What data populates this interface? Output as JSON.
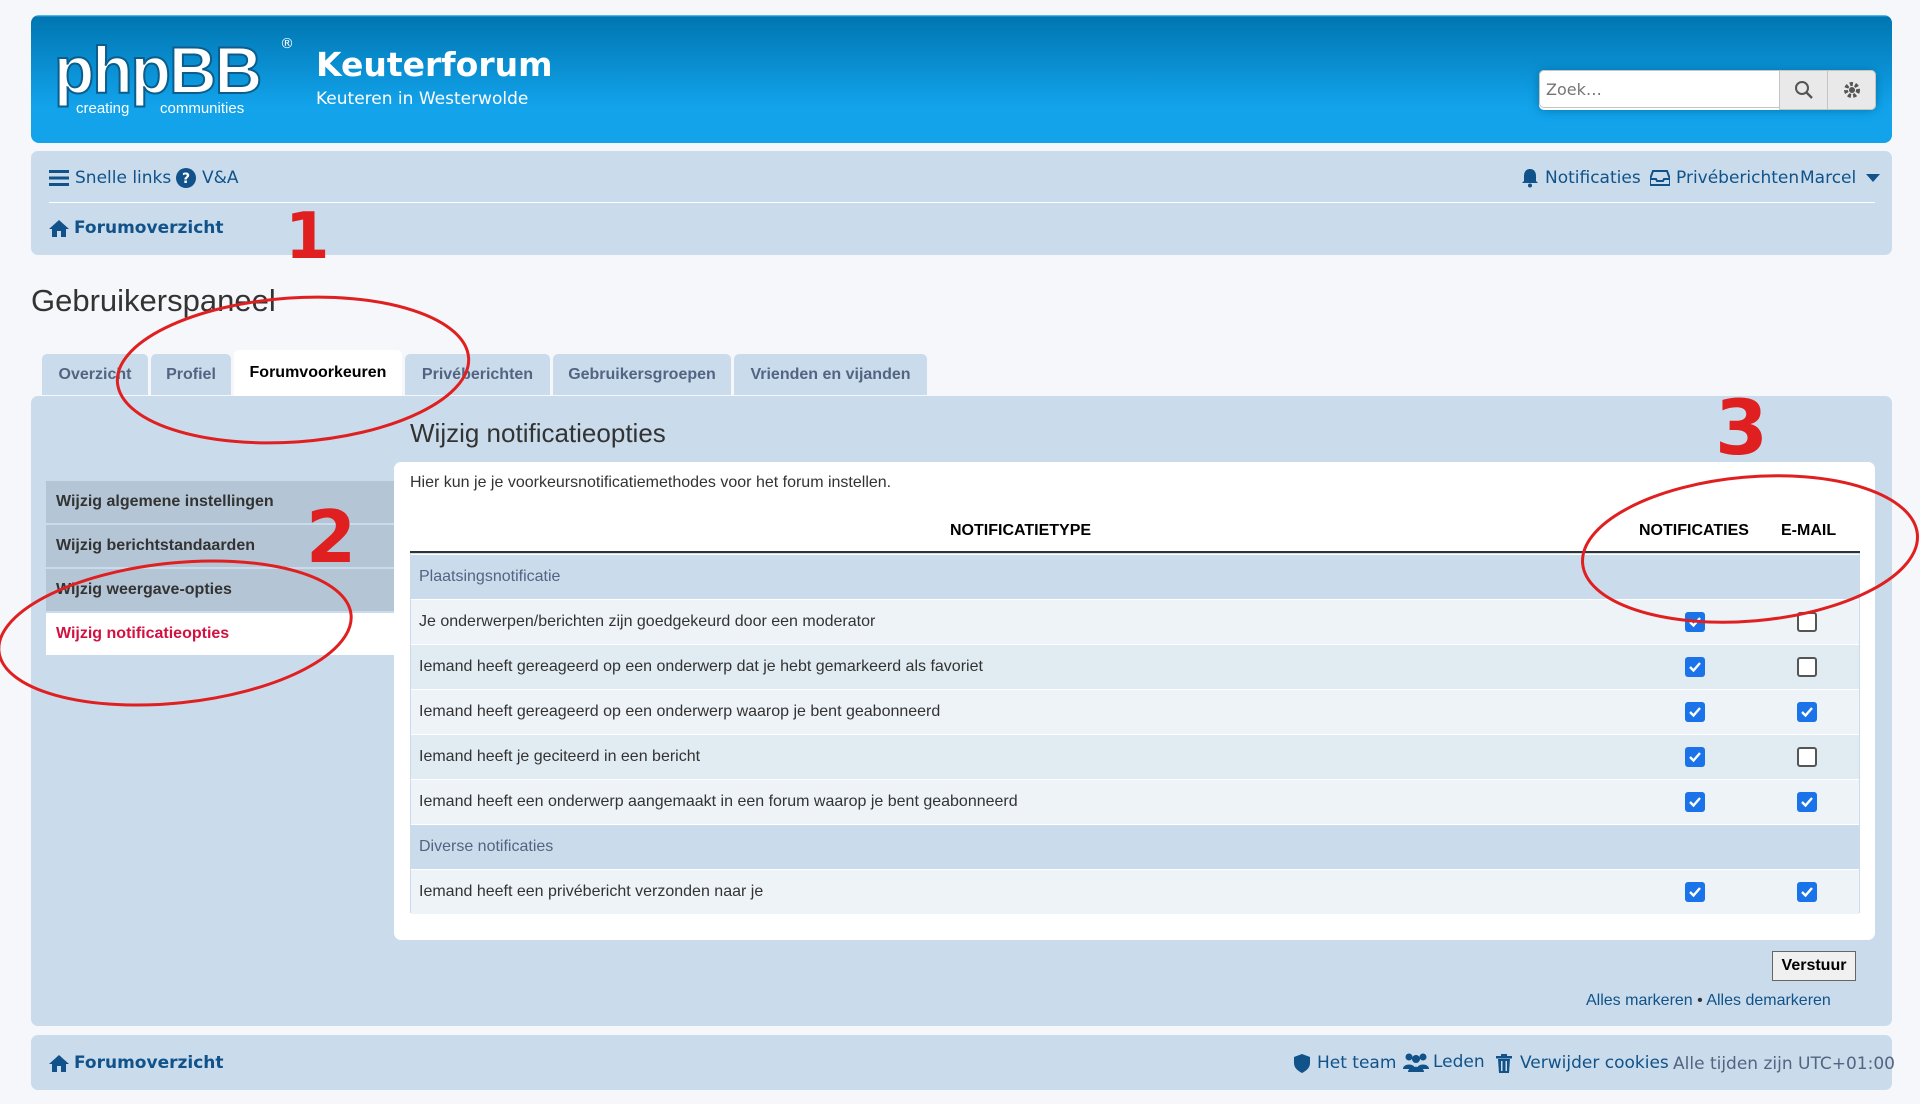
{
  "header": {
    "logo_text": "phpBB",
    "logo_tagline_left": "creating",
    "logo_tagline_right": "communities",
    "site_title": "Keuterforum",
    "site_description": "Keuteren in Westerwolde",
    "search_placeholder": "Zoek…"
  },
  "navbar": {
    "quick_links": "Snelle links",
    "faq": "V&A",
    "notifications": "Notificaties",
    "private_messages": "Privéberichten",
    "username": "Marcel",
    "breadcrumb": "Forumoverzicht"
  },
  "page_title": "Gebruikerspaneel",
  "tabs": [
    {
      "label": "Overzicht"
    },
    {
      "label": "Profiel"
    },
    {
      "label": "Forumvoorkeuren",
      "active": true
    },
    {
      "label": "Privéberichten"
    },
    {
      "label": "Gebruikersgroepen"
    },
    {
      "label": "Vrienden en vijanden"
    }
  ],
  "sidebar": {
    "items": [
      {
        "label": "Wijzig algemene instellingen"
      },
      {
        "label": "Wijzig berichtstandaarden"
      },
      {
        "label": "Wijzig weergave-opties"
      },
      {
        "label": "Wijzig notificatieopties",
        "active": true
      }
    ]
  },
  "content": {
    "title": "Wijzig notificatieopties",
    "intro": "Hier kun je je voorkeursnotificatiemethodes voor het forum instellen.",
    "columns": {
      "type": "NOTIFICATIETYPE",
      "notifications": "NOTIFICATIES",
      "email": "E-MAIL"
    },
    "rows": [
      {
        "group": true,
        "label": "Plaatsingsnotificatie"
      },
      {
        "label": "Je onderwerpen/berichten zijn goedgekeurd door een moderator",
        "notify": true,
        "email": false
      },
      {
        "label": "Iemand heeft gereageerd op een onderwerp dat je hebt gemarkeerd als favoriet",
        "notify": true,
        "email": false
      },
      {
        "label": "Iemand heeft gereageerd op een onderwerp waarop je bent geabonneerd",
        "notify": true,
        "email": true
      },
      {
        "label": "Iemand heeft je geciteerd in een bericht",
        "notify": true,
        "email": false
      },
      {
        "label": "Iemand heeft een onderwerp aangemaakt in een forum waarop je bent geabonneerd",
        "notify": true,
        "email": true
      },
      {
        "group": true,
        "label": "Diverse notificaties"
      },
      {
        "label": "Iemand heeft een privébericht verzonden naar je",
        "notify": true,
        "email": true
      }
    ],
    "submit_label": "Verstuur",
    "mark_all": "Alles markeren",
    "separator": "•",
    "unmark_all": "Alles demarkeren"
  },
  "footer": {
    "breadcrumb": "Forumoverzicht",
    "team": "Het team",
    "members": "Leden",
    "delete_cookies": "Verwijder cookies",
    "timezone": "Alle tijden zijn UTC+01:00"
  },
  "annotations": [
    "1",
    "2",
    "3"
  ],
  "colors": {
    "header_blue": "#12a3eb",
    "panel_bg": "#cadceb",
    "link": "#105289",
    "active_side": "#d31141",
    "annotation_red": "#e02020",
    "checkbox_on": "#1a73e8"
  }
}
